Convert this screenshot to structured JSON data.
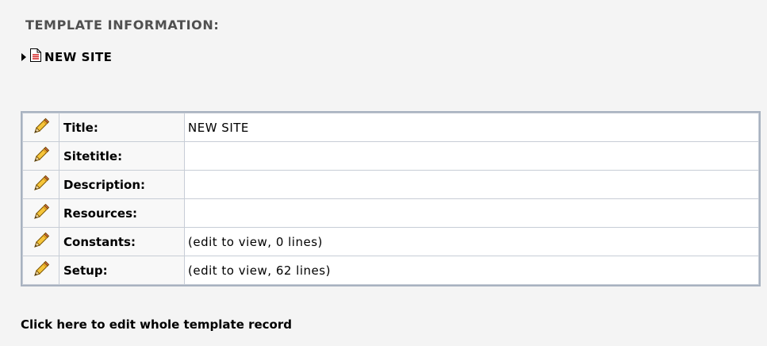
{
  "section_header": "TEMPLATE INFORMATION:",
  "template": {
    "name": "NEW SITE",
    "icon": "template-document-icon"
  },
  "rows": [
    {
      "label": "Title:",
      "value": "NEW SITE",
      "icon": "pencil-icon"
    },
    {
      "label": "Sitetitle:",
      "value": "",
      "icon": "pencil-icon"
    },
    {
      "label": "Description:",
      "value": "",
      "icon": "pencil-icon"
    },
    {
      "label": "Resources:",
      "value": "",
      "icon": "pencil-icon"
    },
    {
      "label": "Constants:",
      "value": "(edit to view, 0 lines)",
      "icon": "pencil-icon"
    },
    {
      "label": "Setup:",
      "value": "(edit to view, 62 lines)",
      "icon": "pencil-icon"
    }
  ],
  "edit_whole_label": "Click here to edit whole template record",
  "colors": {
    "background": "#f4f4f4",
    "table_border": "#a8b2c0",
    "header_text": "#505050"
  }
}
